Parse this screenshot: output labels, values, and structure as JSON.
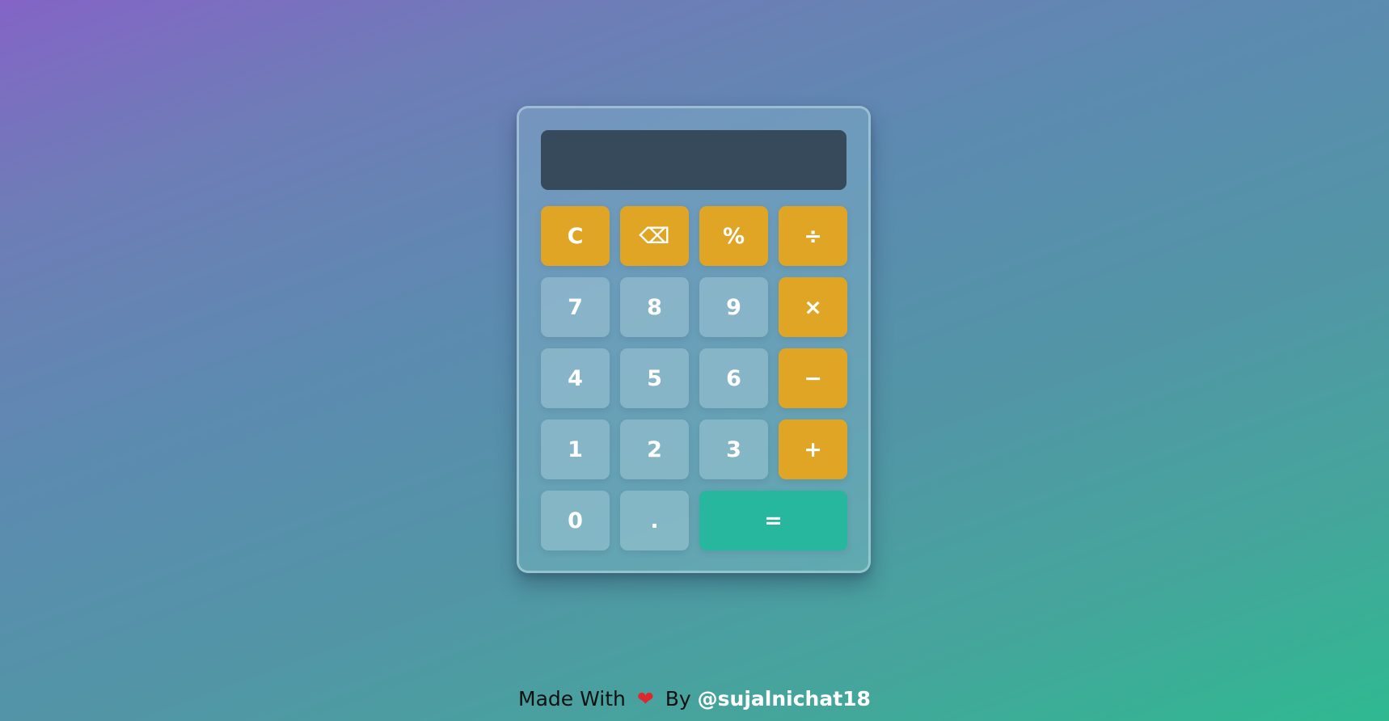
{
  "calculator": {
    "display_value": "",
    "keys": {
      "clear": "C",
      "backspace": "⌫",
      "percent": "%",
      "divide": "÷",
      "seven": "7",
      "eight": "8",
      "nine": "9",
      "multiply": "×",
      "four": "4",
      "five": "5",
      "six": "6",
      "subtract": "−",
      "one": "1",
      "two": "2",
      "three": "3",
      "add": "+",
      "zero": "0",
      "decimal": ".",
      "equals": "="
    }
  },
  "footer": {
    "made_with": "Made With",
    "heart_icon": "heart-icon",
    "by": "By",
    "handle": "@sujalnichat18"
  },
  "colors": {
    "operator_key": "#e0a524",
    "equals_key": "#27b69e",
    "display_bg": "#364a5c",
    "heart": "#e0262e"
  }
}
